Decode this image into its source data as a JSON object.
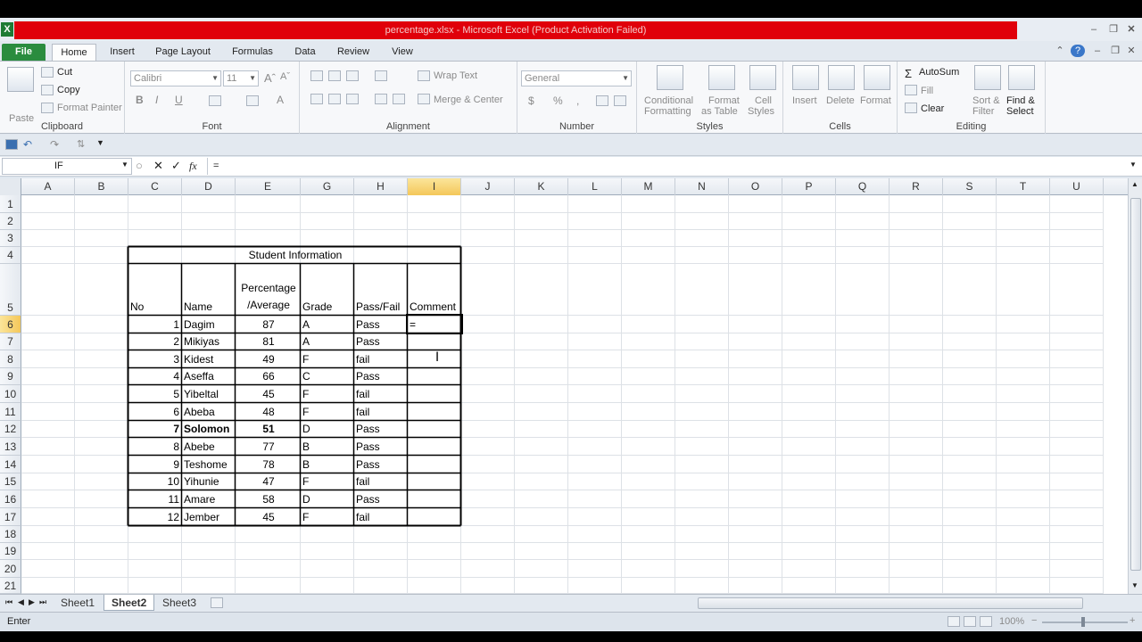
{
  "window": {
    "title": "percentage.xlsx  -  Microsoft Excel (Product Activation Failed)",
    "app_icon": "X"
  },
  "menu": {
    "file": "File",
    "tabs": [
      "Home",
      "Insert",
      "Page Layout",
      "Formulas",
      "Data",
      "Review",
      "View"
    ]
  },
  "ribbon": {
    "clipboard": {
      "paste": "Paste",
      "cut": "Cut",
      "copy": "Copy",
      "format_painter": "Format Painter",
      "label": "Clipboard"
    },
    "font": {
      "font_name": "Calibri",
      "font_size": "11",
      "label": "Font"
    },
    "alignment": {
      "wrap_text": "Wrap Text",
      "merge_center": "Merge & Center",
      "label": "Alignment"
    },
    "number": {
      "format": "General",
      "label": "Number"
    },
    "styles": {
      "conditional": [
        "Conditional",
        "Formatting"
      ],
      "format_table": [
        "Format",
        "as Table"
      ],
      "cell_styles": [
        "Cell",
        "Styles"
      ],
      "label": "Styles"
    },
    "cells": {
      "insert": "Insert",
      "delete": "Delete",
      "format": "Format",
      "label": "Cells"
    },
    "editing": {
      "autosum": "AutoSum",
      "fill": "Fill",
      "clear": "Clear",
      "sort_filter": [
        "Sort &",
        "Filter"
      ],
      "find_select": [
        "Find &",
        "Select"
      ],
      "label": "Editing"
    }
  },
  "formula_bar": {
    "name_box": "IF",
    "formula": "=",
    "fx": "fx"
  },
  "columns": [
    "A",
    "B",
    "C",
    "D",
    "E",
    "G",
    "H",
    "I",
    "J",
    "K",
    "L",
    "M",
    "N",
    "O",
    "P",
    "Q",
    "R",
    "S",
    "T",
    "U"
  ],
  "rows": [
    "1",
    "2",
    "3",
    "4",
    "5",
    "6",
    "7",
    "8",
    "9",
    "10",
    "11",
    "12",
    "13",
    "14",
    "15",
    "16",
    "17",
    "18",
    "19",
    "20",
    "21"
  ],
  "active_column": "I",
  "active_row": "6",
  "table": {
    "title": "Student   Information",
    "headers": {
      "no": "No",
      "name": "Name",
      "pct_line1": "Percentage",
      "pct_line2": "/Average",
      "grade": "Grade",
      "passfail": "Pass/Fail",
      "comment": "Comment"
    },
    "rows": [
      {
        "no": "1",
        "name": "Dagim",
        "pct": "87",
        "grade": "A",
        "pf": "Pass",
        "comment": "="
      },
      {
        "no": "2",
        "name": "Mikiyas",
        "pct": "81",
        "grade": "A",
        "pf": "Pass",
        "comment": ""
      },
      {
        "no": "3",
        "name": "Kidest",
        "pct": "49",
        "grade": "F",
        "pf": "fail",
        "comment": ""
      },
      {
        "no": "4",
        "name": "Aseffa",
        "pct": "66",
        "grade": "C",
        "pf": "Pass",
        "comment": ""
      },
      {
        "no": "5",
        "name": "Yibeltal",
        "pct": "45",
        "grade": "F",
        "pf": "fail",
        "comment": ""
      },
      {
        "no": "6",
        "name": "Abeba",
        "pct": "48",
        "grade": "F",
        "pf": "fail",
        "comment": ""
      },
      {
        "no": "7",
        "name": "Solomon",
        "pct": "51",
        "grade": "D",
        "pf": "Pass",
        "comment": ""
      },
      {
        "no": "8",
        "name": "Abebe",
        "pct": "77",
        "grade": "B",
        "pf": "Pass",
        "comment": ""
      },
      {
        "no": "9",
        "name": "Teshome",
        "pct": "78",
        "grade": "B",
        "pf": "Pass",
        "comment": ""
      },
      {
        "no": "10",
        "name": "Yihunie",
        "pct": "47",
        "grade": "F",
        "pf": "fail",
        "comment": ""
      },
      {
        "no": "11",
        "name": "Amare",
        "pct": "58",
        "grade": "D",
        "pf": "Pass",
        "comment": ""
      },
      {
        "no": "12",
        "name": "Jember",
        "pct": "45",
        "grade": "F",
        "pf": "fail",
        "comment": ""
      }
    ]
  },
  "sheets": [
    "Sheet1",
    "Sheet2",
    "Sheet3"
  ],
  "active_sheet": "Sheet2",
  "status": {
    "mode": "Enter",
    "zoom": "100%"
  },
  "colors": {
    "title_bar": "#e0000a",
    "file_tab": "#2a8c3e",
    "active_header": "#f4c75a"
  }
}
